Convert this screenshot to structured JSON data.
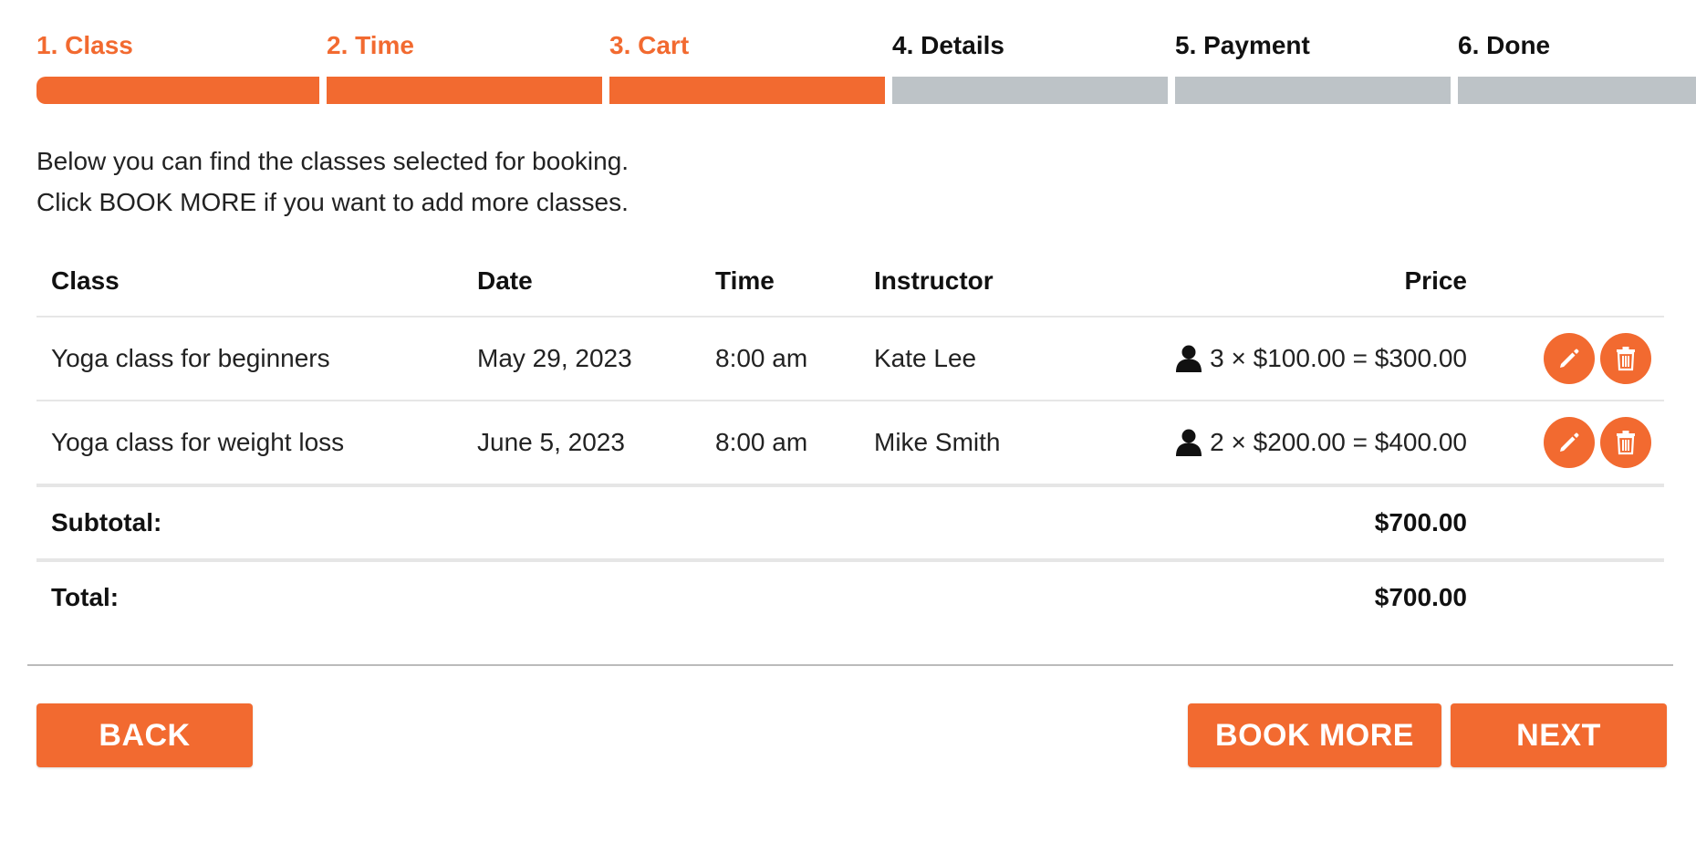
{
  "steps": [
    {
      "label": "1. Class",
      "state": "done"
    },
    {
      "label": "2. Time",
      "state": "done"
    },
    {
      "label": "3. Cart",
      "state": "done"
    },
    {
      "label": "4. Details",
      "state": "todo"
    },
    {
      "label": "5. Payment",
      "state": "todo"
    },
    {
      "label": "6. Done",
      "state": "todo"
    }
  ],
  "intro": {
    "line1": "Below you can find the classes selected for booking.",
    "line2": "Click BOOK MORE if you want to add more classes."
  },
  "table": {
    "headers": {
      "class": "Class",
      "date": "Date",
      "time": "Time",
      "instructor": "Instructor",
      "price": "Price"
    },
    "rows": [
      {
        "class": "Yoga class for beginners",
        "date": "May 29, 2023",
        "time": "8:00 am",
        "instructor": "Kate Lee",
        "price": "3 × $100.00 = $300.00"
      },
      {
        "class": "Yoga class for weight loss",
        "date": "June 5, 2023",
        "time": "8:00 am",
        "instructor": "Mike Smith",
        "price": "2 × $200.00 = $400.00"
      }
    ],
    "subtotal_label": "Subtotal:",
    "subtotal_value": "$700.00",
    "total_label": "Total:",
    "total_value": "$700.00"
  },
  "icons": {
    "person": "person-icon",
    "edit": "pencil-icon",
    "delete": "trash-icon"
  },
  "buttons": {
    "back": "BACK",
    "book_more": "BOOK MORE",
    "next": "NEXT"
  },
  "colors": {
    "accent": "#f26a30",
    "inactive_step": "#bdc3c7"
  }
}
